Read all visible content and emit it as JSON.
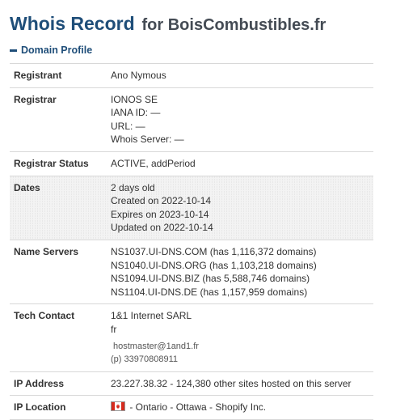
{
  "header": {
    "title_main": "Whois Record",
    "title_for": "for BoisCombustibles.fr"
  },
  "section": {
    "label": "Domain Profile",
    "icon": "minus-icon"
  },
  "registrant": {
    "label": "Registrant",
    "value": "Ano Nymous"
  },
  "registrar": {
    "label": "Registrar",
    "name": "IONOS SE",
    "iana": "IANA ID: —",
    "url": "URL: —",
    "whois_server": "Whois Server: —"
  },
  "registrar_status": {
    "label": "Registrar Status",
    "value": "ACTIVE, addPeriod"
  },
  "dates": {
    "label": "Dates",
    "age": "2 days old",
    "created": "Created on 2022-10-14",
    "expires": "Expires on 2023-10-14",
    "updated": "Updated on 2022-10-14"
  },
  "name_servers": {
    "label": "Name Servers",
    "items": [
      "NS1037.UI-DNS.COM (has 1,116,372 domains)",
      "NS1040.UI-DNS.ORG (has 1,103,218 domains)",
      "NS1094.UI-DNS.BIZ (has 5,588,746 domains)",
      "NS1104.UI-DNS.DE (has 1,157,959 domains)"
    ]
  },
  "tech_contact": {
    "label": "Tech Contact",
    "org": "1&1 Internet SARL",
    "country": "fr",
    "email": "hostmaster@1and1.fr",
    "phone_prefix": "(p)",
    "phone": "33970808911"
  },
  "ip_address": {
    "label": "IP Address",
    "value": "23.227.38.32 - 124,380 other sites hosted on this server"
  },
  "ip_location": {
    "label": "IP Location",
    "flag_icon": "canada-flag-icon",
    "value": "- Ontario - Ottawa - Shopify Inc."
  },
  "colors": {
    "title": "#1f4e79",
    "flag_red": "#d52b1e"
  }
}
